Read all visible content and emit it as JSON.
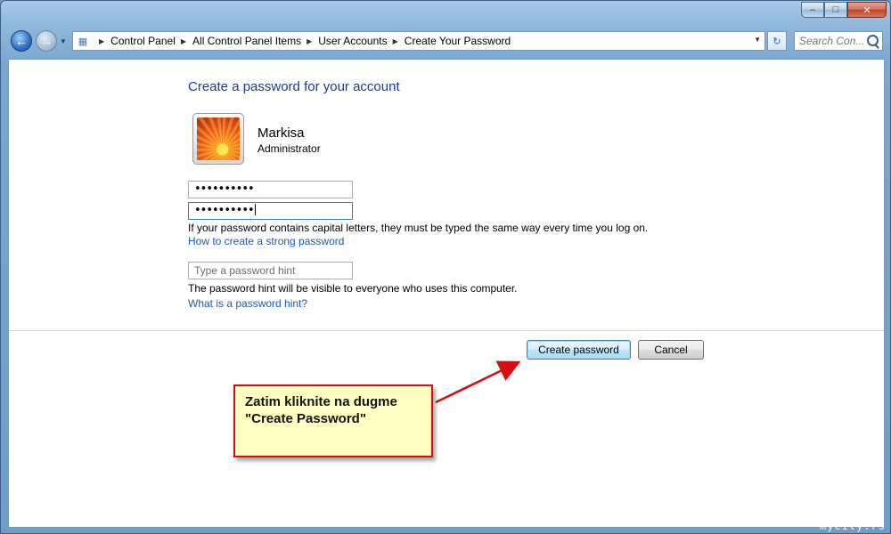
{
  "window": {
    "title_ghost": "",
    "minimize_icon": "minimize-icon",
    "maximize_icon": "maximize-icon",
    "close_icon": "close-icon"
  },
  "nav": {
    "back_icon": "back-arrow-icon",
    "forward_icon": "forward-arrow-icon",
    "breadcrumb": [
      "Control Panel",
      "All Control Panel Items",
      "User Accounts",
      "Create Your Password"
    ],
    "search_placeholder": "Search Con..."
  },
  "page": {
    "heading": "Create a password for your account",
    "user": {
      "name": "Markisa",
      "role": "Administrator"
    },
    "new_password_value": "••••••••••",
    "confirm_password_value": "••••••••••",
    "capital_note": "If your password contains capital letters, they must be typed the same way every time you log on.",
    "strong_password_link": "How to create a strong password",
    "hint_placeholder": "Type a password hint",
    "hint_note": "The password hint will be visible to everyone who uses this computer.",
    "hint_link": "What is a password hint?",
    "create_button": "Create password",
    "cancel_button": "Cancel"
  },
  "callout": {
    "line1": "Zatim kliknite na dugme",
    "line2": "\"Create Password\""
  },
  "watermark": "mycity.rs",
  "colors": {
    "accent": "#d40f0f",
    "heading": "#1e3a8a",
    "link": "#1a59bd",
    "callout_bg": "#ffffc4"
  }
}
